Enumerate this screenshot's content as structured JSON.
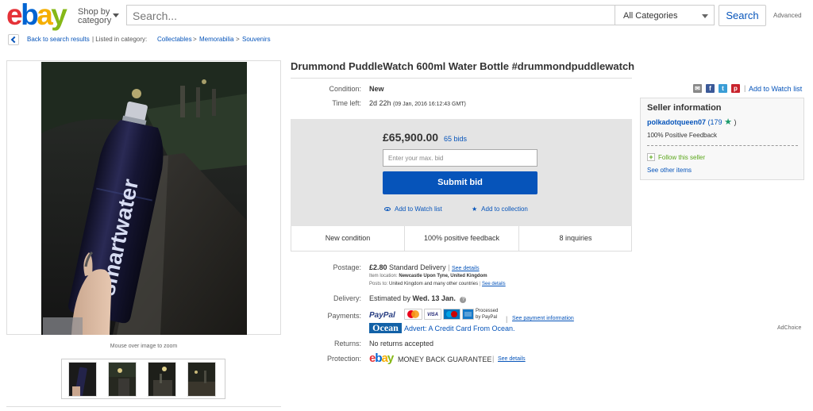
{
  "header": {
    "logo_letters": [
      "e",
      "b",
      "a",
      "y"
    ],
    "shop_by_line1": "Shop by",
    "shop_by_line2": "category",
    "search_placeholder": "Search...",
    "category_select": "All Categories",
    "search_button": "Search",
    "advanced_link": "Advanced"
  },
  "breadcrumb": {
    "back_label": "Back to search results",
    "listed_in": "| Listed in category:",
    "categories": [
      "Collectables",
      "Memorabilia",
      "Souvenirs"
    ],
    "separator": ">"
  },
  "gallery": {
    "mouse_over_hint": "Mouse over image to zoom",
    "photo_brand_text": "smartwater",
    "thumbnail_count": 4
  },
  "listing": {
    "title": "Drummond PuddleWatch 600ml Water Bottle #drummondpuddlewatch",
    "condition_label": "Condition:",
    "condition_value": "New",
    "time_left_label": "Time left:",
    "time_left_value": "2d 22h",
    "time_left_date": "(09 Jan, 2016  16:12:43 GMT)",
    "add_to_watch_list_top": "Add to Watch list",
    "share_icons": [
      "email-icon",
      "facebook-icon",
      "twitter-icon",
      "pinterest-icon"
    ]
  },
  "bid": {
    "price": "£65,900.00",
    "bids": "65 bids",
    "input_placeholder": "Enter your max. bid",
    "submit_label": "Submit bid",
    "watch_label": "Add to Watch list",
    "collection_label": "Add to collection"
  },
  "stats": [
    "New condition",
    "100% positive feedback",
    "8 inquiries"
  ],
  "seller": {
    "title": "Seller information",
    "name": "polkadotqueen07",
    "feedback_count": "(179",
    "feedback_close": ")",
    "positive_feedback": "100% Positive Feedback",
    "follow_label": "Follow this seller",
    "other_items": "See other items"
  },
  "shipping": {
    "postage_label": "Postage:",
    "postage_price": "£2.80",
    "postage_service": "Standard Delivery",
    "see_details": "See details",
    "item_location_label": "Item location:",
    "item_location": "Newcastle Upon Tyne, United Kingdom",
    "posts_to_label": "Posts to:",
    "posts_to": "United Kingdom and many other countries",
    "delivery_label": "Delivery:",
    "delivery_prefix": "Estimated by",
    "delivery_date": "Wed. 13 Jan.",
    "payments_label": "Payments:",
    "paypal": "PayPal",
    "processed_by": "Processed",
    "processed_by2": "by PayPal",
    "see_payment_info": "See payment information",
    "ocean_logo": "Ocean",
    "ocean_advert": "Advert: A Credit Card From Ocean.",
    "adchoice": "AdChoice",
    "returns_label": "Returns:",
    "returns_value": "No returns accepted",
    "protection_label": "Protection:",
    "money_back": "MONEY BACK GUARANTEE",
    "protection_details": "See details"
  },
  "colors": {
    "link": "#0654ba",
    "submit_button": "#0654ba",
    "bid_box": "#e4e4e4",
    "follow_green": "#5ba71b"
  }
}
